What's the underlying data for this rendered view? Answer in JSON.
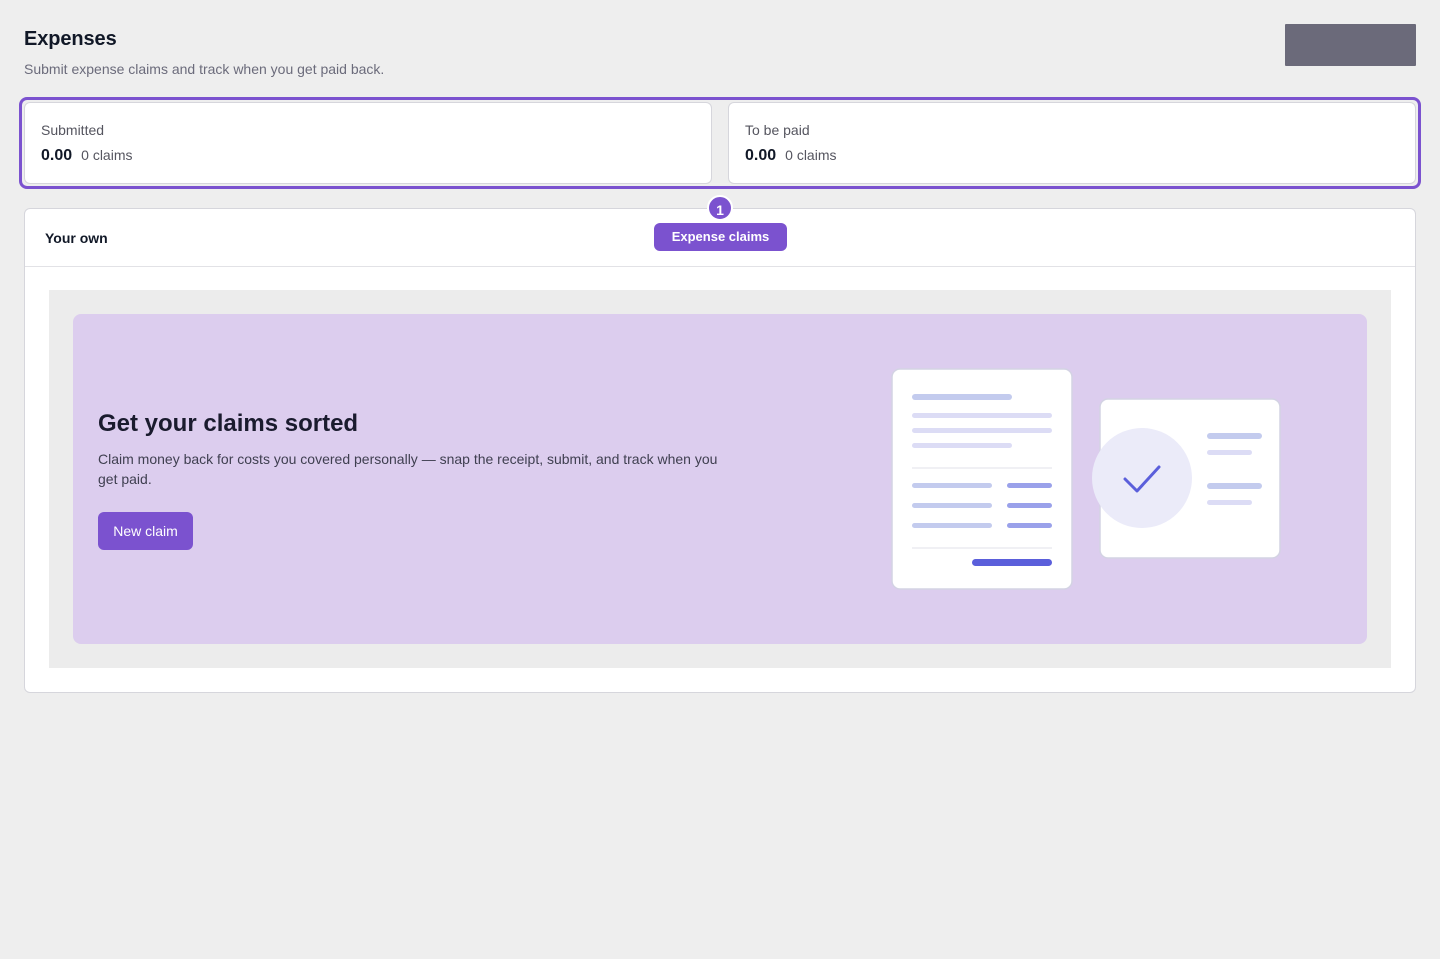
{
  "page": {
    "title": "Expenses",
    "subtitle": "Submit expense claims and track when you get paid back."
  },
  "summary": {
    "submitted": {
      "label": "Submitted",
      "amount": "0.00",
      "count": "0 claims"
    },
    "to_be_paid": {
      "label": "To be paid",
      "amount": "0.00",
      "count": "0 claims"
    }
  },
  "main_card": {
    "header_title": "Your own",
    "tab": {
      "label": "Expense claims",
      "step": "1"
    }
  },
  "empty_state": {
    "title": "Get your claims sorted",
    "description": "Claim money back for costs you covered personally — snap the receipt, submit, and track when you get paid.",
    "cta_label": "New claim",
    "illustration": "receipt-approved-illustration"
  },
  "colors": {
    "accent": "#7b52cf",
    "panel_bg": "#dccdee",
    "page_bg": "#eeeeee",
    "illustration_accent": "#5b5fdb"
  }
}
